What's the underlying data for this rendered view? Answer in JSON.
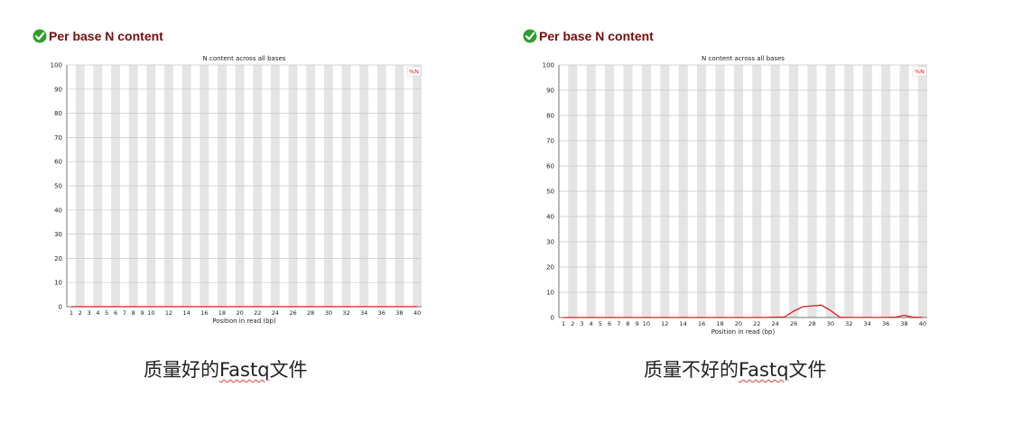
{
  "panels": [
    {
      "heading": "Per base N content",
      "caption_prefix": "质量好的",
      "caption_ascii": "Fastq",
      "caption_suffix": "文件"
    },
    {
      "heading": "Per base N content",
      "caption_prefix": "质量不好的",
      "caption_ascii": "Fastq",
      "caption_suffix": "文件"
    }
  ],
  "colors": {
    "heading": "#7a0b0b",
    "series": "#dc1e1e",
    "stripe": "#e5e5e5",
    "grid": "#c8c8c8",
    "check": "#2e9e2e"
  },
  "chart_data": [
    {
      "type": "line",
      "title": "N content across all bases",
      "xlabel": "Position in read (bp)",
      "ylabel": "",
      "ylim": [
        0,
        100
      ],
      "yticks": [
        0,
        10,
        20,
        30,
        40,
        50,
        60,
        70,
        80,
        90,
        100
      ],
      "x": [
        "1",
        "2",
        "3",
        "4",
        "5",
        "6",
        "7",
        "8",
        "9",
        "10",
        "11",
        "12",
        "13",
        "14",
        "15",
        "16",
        "17",
        "18",
        "19",
        "20",
        "21",
        "22",
        "23",
        "24",
        "25",
        "26",
        "27",
        "28",
        "29",
        "30",
        "31",
        "32",
        "33",
        "34",
        "35",
        "36",
        "37",
        "38",
        "39",
        "40"
      ],
      "xtick_labels": [
        "1",
        "2",
        "3",
        "4",
        "5",
        "6",
        "7",
        "8",
        "9",
        "10",
        "12",
        "14",
        "16",
        "18",
        "20",
        "22",
        "24",
        "26",
        "28",
        "30",
        "32",
        "34",
        "36",
        "38",
        "40"
      ],
      "legend": "top-right",
      "series": [
        {
          "name": "%N",
          "values": [
            0,
            0,
            0,
            0,
            0,
            0,
            0,
            0,
            0,
            0,
            0,
            0,
            0,
            0,
            0,
            0,
            0,
            0,
            0,
            0,
            0,
            0,
            0,
            0,
            0,
            0,
            0,
            0,
            0,
            0,
            0,
            0,
            0,
            0,
            0,
            0,
            0,
            0,
            0,
            0
          ]
        }
      ]
    },
    {
      "type": "line",
      "title": "N content across all bases",
      "xlabel": "Position in read (bp)",
      "ylabel": "",
      "ylim": [
        0,
        100
      ],
      "yticks": [
        0,
        10,
        20,
        30,
        40,
        50,
        60,
        70,
        80,
        90,
        100
      ],
      "x": [
        "1",
        "2",
        "3",
        "4",
        "5",
        "6",
        "7",
        "8",
        "9",
        "10",
        "11",
        "12",
        "13",
        "14",
        "15",
        "16",
        "17",
        "18",
        "19",
        "20",
        "21",
        "22",
        "23",
        "24",
        "25",
        "26",
        "27",
        "28",
        "29",
        "30",
        "31",
        "32",
        "33",
        "34",
        "35",
        "36",
        "37",
        "38",
        "39",
        "40"
      ],
      "xtick_labels": [
        "1",
        "2",
        "3",
        "4",
        "5",
        "6",
        "7",
        "8",
        "9",
        "10",
        "12",
        "14",
        "16",
        "18",
        "20",
        "22",
        "24",
        "26",
        "28",
        "30",
        "32",
        "34",
        "36",
        "38",
        "40"
      ],
      "legend": "top-right",
      "series": [
        {
          "name": "%N",
          "values": [
            0,
            0,
            0,
            0,
            0,
            0,
            0,
            0,
            0,
            0,
            0,
            0,
            0,
            0,
            0,
            0,
            0,
            0,
            0,
            0,
            0,
            0,
            0.05,
            0.1,
            0.2,
            2.5,
            4.3,
            4.6,
            4.9,
            2.8,
            0.1,
            0.05,
            0.05,
            0.05,
            0.05,
            0.05,
            0.1,
            0.9,
            0.1,
            0.05
          ]
        }
      ]
    }
  ]
}
